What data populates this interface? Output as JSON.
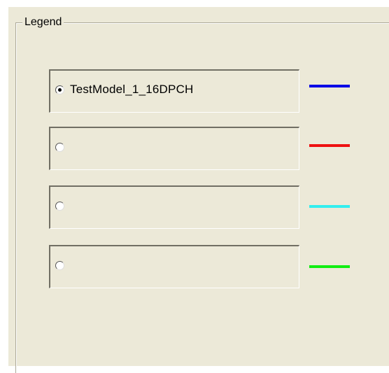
{
  "legend": {
    "title": "Legend",
    "entries": [
      {
        "label": "TestModel_1_16DPCH",
        "selected": true,
        "color": "#0000e6"
      },
      {
        "label": "",
        "selected": false,
        "color": "#ee1111"
      },
      {
        "label": "",
        "selected": false,
        "color": "#33eeee"
      },
      {
        "label": "",
        "selected": false,
        "color": "#11ee11"
      }
    ]
  }
}
